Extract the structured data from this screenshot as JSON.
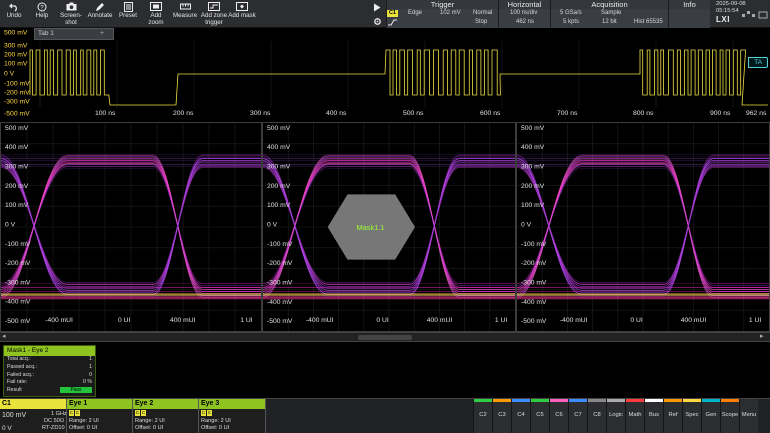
{
  "toolbar": {
    "undo": "Undo",
    "help": "Help",
    "screenshot": "Screen-\nshot",
    "annotate": "Annotate",
    "preset": "Preset",
    "add_zoom": "Add\nzoom",
    "measure": "Measure",
    "add_zone_trigger": "Add zone\ntrigger",
    "add_mask": "Add mask"
  },
  "trigger": {
    "title": "Trigger",
    "source": "C1",
    "type": "Edge",
    "level": "102 mV",
    "mode": "Normal",
    "state": "Stop"
  },
  "horizontal": {
    "title": "Horizontal",
    "scale": "100 ns/div",
    "position": "462 ns"
  },
  "acquisition": {
    "title": "Acquisition",
    "rate": "5 GSa/s",
    "points": "5 kpts",
    "mode": "Sample",
    "bits": "12 bit",
    "hist": "Hist 65535"
  },
  "info": {
    "title": "Info"
  },
  "datetime": {
    "date": "2025-09-08",
    "time": "05:15:54"
  },
  "brand": "LXI",
  "diagram_tab": "Tab 1",
  "top_wave": {
    "y_ticks": [
      "500 mV",
      "300 mV",
      "200 mV",
      "100 mV",
      "0 V",
      "-100 mV",
      "-200 mV",
      "-300 mV",
      "-500 mV"
    ],
    "x_ticks": [
      "100 ns",
      "200 ns",
      "300 ns",
      "400 ns",
      "500 ns",
      "600 ns",
      "700 ns",
      "800 ns",
      "900 ns",
      "962 ns"
    ],
    "marker": "TA"
  },
  "eyes": {
    "y_ticks": [
      "500 mV",
      "400 mV",
      "300 mV",
      "200 mV",
      "100 mV",
      "0 V",
      "-100 mV",
      "-200 mV",
      "-300 mV",
      "-400 mV",
      "-500 mV"
    ],
    "x_ticks": [
      "-400 mUI",
      "0 UI",
      "400 mUI",
      "1 UI"
    ],
    "mask_label": "Mask1.1"
  },
  "mask_table": {
    "title": "Mask1 - Eye 2",
    "rows": [
      {
        "label": "Total acq.:",
        "value": "1"
      },
      {
        "label": "Passed acq.:",
        "value": "1"
      },
      {
        "label": "Failed acq.:",
        "value": "0"
      },
      {
        "label": "Fail rate:",
        "value": "0 %"
      },
      {
        "label": "Result",
        "value": "Pass"
      }
    ]
  },
  "signals": {
    "c1": {
      "name": "C1",
      "scale": "100 mV",
      "offset": "0 V",
      "freq": "1 GHz",
      "coupling": "DC 50Ω",
      "probe": "RT-ZD10"
    },
    "eye1": {
      "name": "Eye 1",
      "range": "Range: 2 UI",
      "offset": "Offset: 0 UI"
    },
    "eye2": {
      "name": "Eye 2",
      "range": "Range: 2 UI",
      "offset": "Offset: 0 UI"
    },
    "eye3": {
      "name": "Eye 3",
      "range": "Range: 2 UI",
      "offset": "Offset: 0 UI"
    }
  },
  "channel_buttons": [
    {
      "label": "C2",
      "color": "#2ecc40"
    },
    {
      "label": "C3",
      "color": "#ff9900"
    },
    {
      "label": "C4",
      "color": "#3b8cff"
    },
    {
      "label": "C5",
      "color": "#2ecc40"
    },
    {
      "label": "C6",
      "color": "#ff5fbf"
    },
    {
      "label": "C7",
      "color": "#3b8cff"
    },
    {
      "label": "C8",
      "color": "#888888"
    },
    {
      "label": "Logic",
      "color": "#aaaaaa"
    },
    {
      "label": "Math",
      "color": "#ff3b3b"
    },
    {
      "label": "Bus",
      "color": "#ffffff"
    },
    {
      "label": "Ref",
      "color": "#ff9900"
    },
    {
      "label": "Spec",
      "color": "#ffd740"
    },
    {
      "label": "Gen",
      "color": "#00b4c8"
    },
    {
      "label": "Scope",
      "color": "#ff7f00"
    },
    {
      "label": "Menu",
      "color": "#2b2d31"
    }
  ]
}
